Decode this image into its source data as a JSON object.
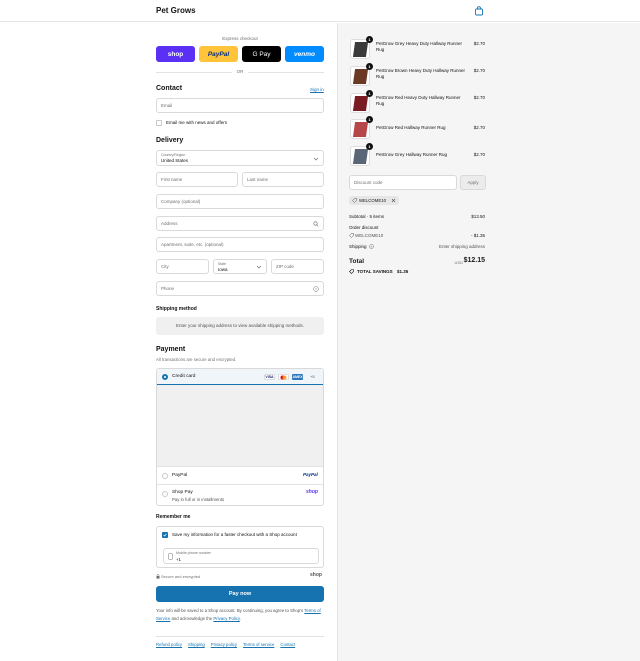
{
  "header": {
    "brand": "Pet Grows",
    "cart_icon": "shopping-bag-icon"
  },
  "express": {
    "label": "Express checkout",
    "buttons": [
      {
        "name": "shop",
        "label": "shop"
      },
      {
        "name": "paypal",
        "label": "PayPal"
      },
      {
        "name": "gpay",
        "label": "G Pay"
      },
      {
        "name": "venmo",
        "label": "venmo"
      }
    ],
    "or": "OR"
  },
  "contact": {
    "title": "Contact",
    "signin": "Sign in",
    "email_placeholder": "Email",
    "newsletter_label": "Email me with news and offers"
  },
  "delivery": {
    "title": "Delivery",
    "country_label": "Country/Region",
    "country_value": "United States",
    "first_name": "First name",
    "last_name": "Last name",
    "company": "Company (optional)",
    "address": "Address",
    "apartment": "Apartment, suite, etc. (optional)",
    "city": "City",
    "state_label": "State",
    "state_value": "Iowa",
    "zip": "ZIP code",
    "phone": "Phone"
  },
  "shipping": {
    "title": "Shipping method",
    "message": "Enter your shipping address to view available shipping methods."
  },
  "payment": {
    "title": "Payment",
    "subtitle": "All transactions are secure and encrypted.",
    "credit_card": "Credit card",
    "card_brands": [
      "VISA",
      "MC",
      "AMEX"
    ],
    "more_brands": "+5",
    "paypal": "PayPal",
    "paypal_logo": "PayPal",
    "shoppay": "Shop Pay",
    "shoppay_sub": "Pay in full or in installments",
    "shoppay_logo": "shop"
  },
  "remember": {
    "title": "Remember me",
    "save_label": "Save my information for a faster checkout with a Shop account",
    "mobile_label": "Mobile phone number",
    "mobile_prefix": "+1",
    "secure": "Secure and encrypted",
    "shop_logo": "shop"
  },
  "pay_now": "Pay now",
  "legal": {
    "text1": "Your info will be saved to a Shop account. By continuing, you agree to Shop's",
    "tos": "Terms of Service",
    "text2": "and acknowledge the",
    "privacy": "Privacy Policy",
    "end": "."
  },
  "footer": [
    "Refund policy",
    "Shipping",
    "Privacy policy",
    "Terms of service",
    "Contact"
  ],
  "cart": {
    "items": [
      {
        "name": "PetGrow Grey Heavy Duty Hallway Runner Rug",
        "price": "$2.70",
        "qty": "1",
        "color": "#3a3a3a"
      },
      {
        "name": "PetGrow Brown Heavy Duty Hallway Runner Rug",
        "price": "$2.70",
        "qty": "1",
        "color": "#6b3a24"
      },
      {
        "name": "PetGrow Red Heavy Duty Hallway Runner Rug",
        "price": "$2.70",
        "qty": "1",
        "color": "#7a1d22"
      },
      {
        "name": "PetGrow Red Hallway Runner Rug",
        "price": "$2.70",
        "qty": "1",
        "color": "#b5474a"
      },
      {
        "name": "PetGrow Grey Hallway Runner Rug",
        "price": "$2.70",
        "qty": "1",
        "color": "#5a6675"
      }
    ],
    "discount_placeholder": "Discount code",
    "apply": "Apply",
    "applied_code": "WELCOME10",
    "subtotal_label": "Subtotal · 5 items",
    "subtotal": "$13.50",
    "order_discount_label": "Order discount",
    "discount_code": "WELCOME10",
    "discount_value": "- $1.35",
    "shipping_label": "Shipping",
    "shipping_value": "Enter shipping address",
    "total_label": "Total",
    "currency": "USD",
    "total": "$12.15",
    "savings_label": "TOTAL SAVINGS",
    "savings": "$1.35"
  },
  "colors": {
    "accent": "#1773b0",
    "shop": "#5a31f4",
    "paypal": "#ffc439",
    "venmo": "#008cff"
  }
}
